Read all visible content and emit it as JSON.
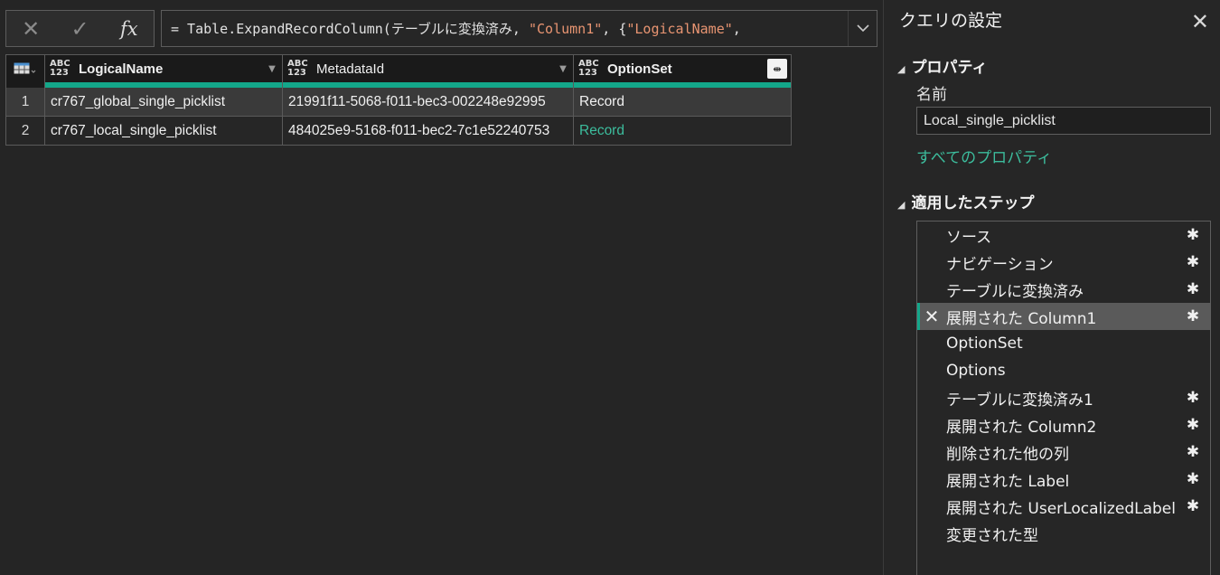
{
  "formula_bar": {
    "cancel_icon": "x-icon",
    "confirm_icon": "check-icon",
    "fx_label": "fx",
    "prefix": "= Table.ExpandRecordColumn(テーブルに変換済み, ",
    "str1": "\"Column1\"",
    "mid": ", {",
    "str2": "\"LogicalName\"",
    "suffix": ","
  },
  "grid": {
    "columns": [
      {
        "type_top": "ABC",
        "type_bottom": "123",
        "name": "LogicalName"
      },
      {
        "type_top": "ABC",
        "type_bottom": "123",
        "name": "MetadataId"
      },
      {
        "type_top": "ABC",
        "type_bottom": "123",
        "name": "OptionSet"
      }
    ],
    "rows": [
      {
        "n": "1",
        "logical": "cr767_global_single_picklist",
        "meta": "21991f11-5068-f011-bec3-002248e92995",
        "option": "Record"
      },
      {
        "n": "2",
        "logical": "cr767_local_single_picklist",
        "meta": "484025e9-5168-f011-bec2-7c1e52240753",
        "option": "Record"
      }
    ]
  },
  "pane": {
    "title": "クエリの設定",
    "properties_heading": "プロパティ",
    "name_label": "名前",
    "name_value": "Local_single_picklist",
    "all_properties": "すべてのプロパティ",
    "steps_heading": "適用したステップ",
    "steps": [
      {
        "label": "ソース",
        "gear": true
      },
      {
        "label": "ナビゲーション",
        "gear": true
      },
      {
        "label": "テーブルに変換済み",
        "gear": true
      },
      {
        "label": "展開された Column1",
        "gear": true,
        "selected": true
      },
      {
        "label": "OptionSet",
        "gear": false
      },
      {
        "label": "Options",
        "gear": false
      },
      {
        "label": "テーブルに変換済み1",
        "gear": true
      },
      {
        "label": "展開された Column2",
        "gear": true
      },
      {
        "label": "削除された他の列",
        "gear": true
      },
      {
        "label": "展開された Label",
        "gear": true
      },
      {
        "label": "展開された UserLocalizedLabel",
        "gear": true
      },
      {
        "label": "変更された型",
        "gear": false
      }
    ]
  },
  "colors": {
    "accent": "#13a78a",
    "link": "#3cbd9d",
    "string": "#e99572"
  }
}
